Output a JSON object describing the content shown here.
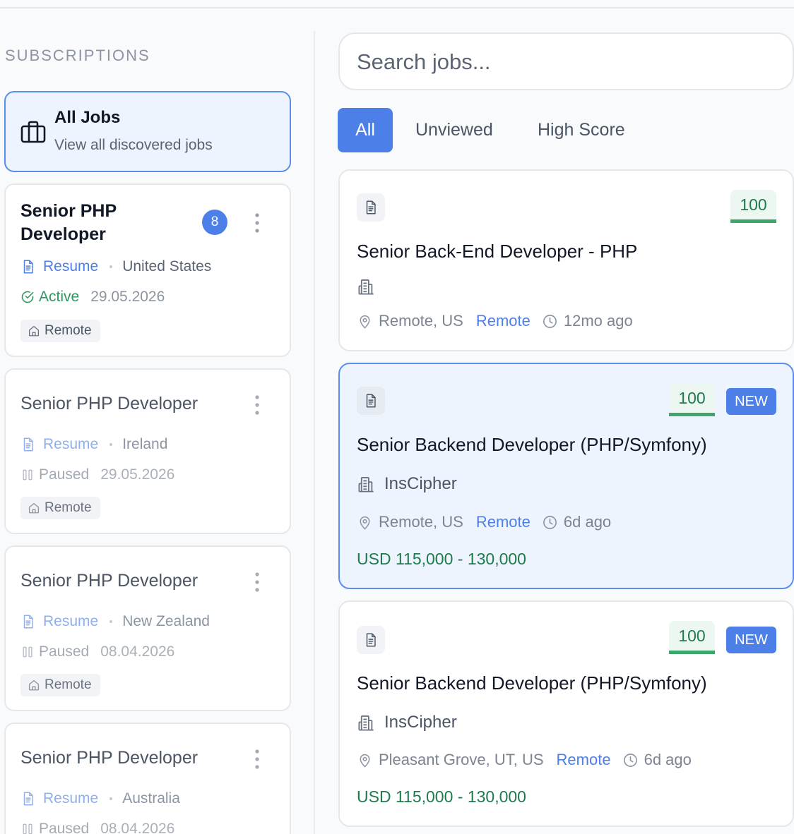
{
  "sidebar": {
    "heading": "SUBSCRIPTIONS",
    "all_jobs": {
      "title": "All Jobs",
      "subtitle": "View all discovered jobs",
      "icon": "briefcase-icon"
    },
    "subscriptions": [
      {
        "name": "Senior PHP Developer",
        "count": "8",
        "resume": "Resume",
        "country": "United States",
        "status": "Active",
        "date": "29.05.2026",
        "work_type": "Remote"
      },
      {
        "name": "Senior PHP Developer",
        "resume": "Resume",
        "country": "Ireland",
        "status": "Paused",
        "date": "29.05.2026",
        "work_type": "Remote"
      },
      {
        "name": "Senior PHP Developer",
        "resume": "Resume",
        "country": "New Zealand",
        "status": "Paused",
        "date": "08.04.2026",
        "work_type": "Remote"
      },
      {
        "name": "Senior PHP Developer",
        "resume": "Resume",
        "country": "Australia",
        "status": "Paused",
        "date": "08.04.2026"
      }
    ]
  },
  "search": {
    "placeholder": "Search jobs..."
  },
  "filters": {
    "tabs": [
      "All",
      "Unviewed",
      "High Score"
    ],
    "selected": "All"
  },
  "jobs": [
    {
      "score": "100",
      "title": "Senior Back-End Developer - PHP",
      "company": "",
      "location": "Remote, US",
      "work_type": "Remote",
      "age": "12mo ago"
    },
    {
      "score": "100",
      "badge": "NEW",
      "title": "Senior Backend Developer (PHP/Symfony)",
      "company": "InsCipher",
      "location": "Remote, US",
      "work_type": "Remote",
      "age": "6d ago",
      "salary": "USD 115,000 - 130,000"
    },
    {
      "score": "100",
      "badge": "NEW",
      "title": "Senior Backend Developer (PHP/Symfony)",
      "company": "InsCipher",
      "location": "Pleasant Grove, UT, US",
      "work_type": "Remote",
      "age": "6d ago",
      "salary": "USD 115,000 - 130,000"
    }
  ],
  "colors": {
    "accent": "#4c7fe8",
    "success": "#2f9461",
    "score_bg": "#ebf7f0",
    "selected_bg": "#eef4fd"
  }
}
